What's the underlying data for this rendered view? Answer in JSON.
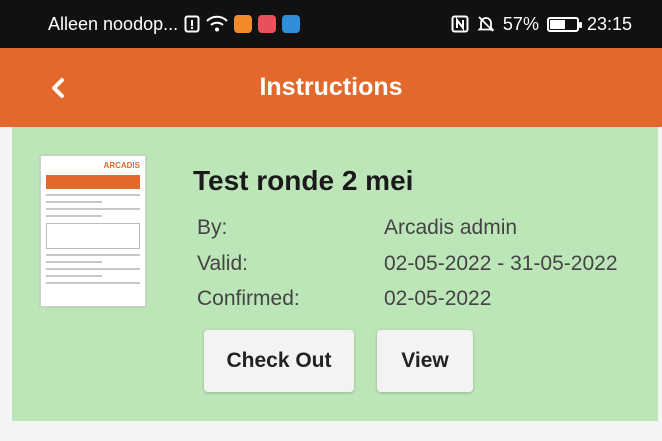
{
  "status_bar": {
    "carrier_text": "Alleen noodop...",
    "icons": [
      "sim-alert-icon",
      "wifi-icon",
      "app-notification-icon",
      "app-notification-icon",
      "app-notification-icon"
    ],
    "right_icons": [
      "nfc-icon",
      "silent-icon"
    ],
    "battery_percent": "57%",
    "battery_level": 0.57,
    "time": "23:15"
  },
  "app_bar": {
    "back_icon": "chevron-left-icon",
    "title": "Instructions",
    "color": "#e2682c"
  },
  "instruction": {
    "title": "Test ronde 2 mei",
    "by_label": "By:",
    "by_value": "Arcadis admin",
    "valid_label": "Valid:",
    "valid_value": "02-05-2022 - 31-05-2022",
    "confirmed_label": "Confirmed:",
    "confirmed_value": "02-05-2022",
    "card_color": "#bde6b8",
    "thumbnail_brand": "ARCADIS"
  },
  "buttons": {
    "check_out": "Check Out",
    "view": "View"
  }
}
